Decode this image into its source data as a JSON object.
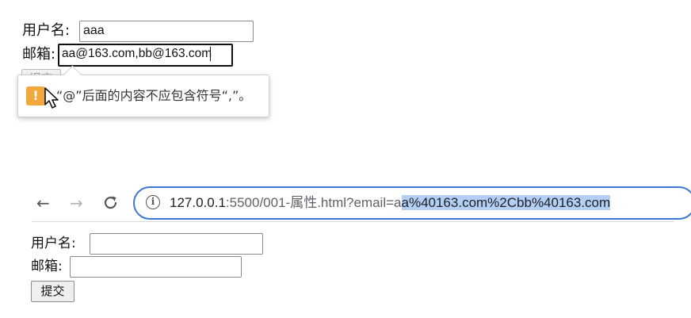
{
  "top_form": {
    "username_label": "用户名:",
    "username_value": "aaa",
    "email_label": "邮箱:",
    "email_value": "aa@163.com,bb@163.com",
    "submit_label": "提交"
  },
  "validation_tooltip": {
    "message": "“@”后面的内容不应包含符号“,”。",
    "icon": "warning-icon"
  },
  "browser": {
    "back_icon": "←",
    "forward_icon": "→",
    "reload_icon": "C",
    "info_icon": "i",
    "url_host": "127.0.0.1",
    "url_path": ":5500/001-属性.html?email=a",
    "url_selected": "a%40163.com%2Cbb%40163.com"
  },
  "bottom_form": {
    "username_label": "用户名:",
    "username_value": "",
    "email_label": "邮箱:",
    "email_value": "",
    "submit_label": "提交"
  },
  "colors": {
    "accent": "#3d78d8",
    "selection": "#b4cff5",
    "warning": "#f2a93b"
  }
}
